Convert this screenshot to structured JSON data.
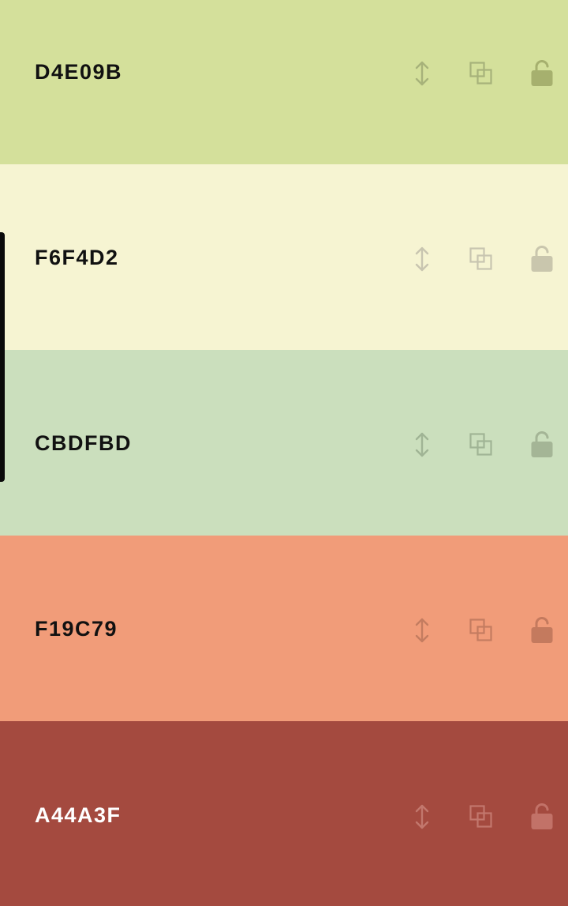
{
  "swatches": [
    {
      "hex": "D4E09B",
      "background": "#D4E09B",
      "text_color": "#111111",
      "icon_color": "#A7B27A",
      "lock_color": "#A6B06E"
    },
    {
      "hex": "F6F4D2",
      "background": "#F6F4D2",
      "text_color": "#111111",
      "icon_color": "#C8C5B0",
      "lock_color": "#C9C6AD"
    },
    {
      "hex": "CBDFBD",
      "background": "#CBDFBD",
      "text_color": "#111111",
      "icon_color": "#A0B495",
      "lock_color": "#A4B596"
    },
    {
      "hex": "F19C79",
      "background": "#F19C79",
      "text_color": "#111111",
      "icon_color": "#C47C60",
      "lock_color": "#C47A5E"
    },
    {
      "hex": "A44A3F",
      "background": "#A44A3F",
      "text_color": "#FFFFFF",
      "icon_color": "#C2776D",
      "lock_color": "#C27268"
    }
  ],
  "icons": {
    "drag": "vertical-arrows-icon",
    "copy": "copy-icon",
    "lock": "unlocked-padlock-icon"
  }
}
